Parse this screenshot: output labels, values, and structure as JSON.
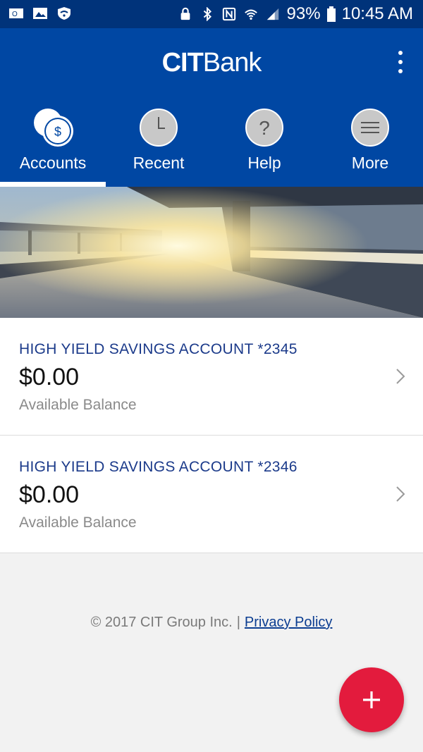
{
  "status_bar": {
    "left_icons": [
      "outlook-icon",
      "image-icon",
      "shield-wifi-icon"
    ],
    "right_icons": [
      "lock-icon",
      "bluetooth-icon",
      "nfc-icon",
      "wifi-icon",
      "signal-icon"
    ],
    "battery": "93%",
    "time": "10:45 AM"
  },
  "header": {
    "logo_cit": "CIT",
    "logo_bank": "Bank"
  },
  "tabs": [
    {
      "label": "Accounts",
      "icon": "accounts-icon",
      "active": true
    },
    {
      "label": "Recent",
      "icon": "clock-icon",
      "active": false
    },
    {
      "label": "Help",
      "icon": "help-icon",
      "active": false
    },
    {
      "label": "More",
      "icon": "menu-icon",
      "active": false
    }
  ],
  "accounts": [
    {
      "title": "HIGH YIELD SAVINGS ACCOUNT *2345",
      "balance": "$0.00",
      "caption": "Available Balance"
    },
    {
      "title": "HIGH YIELD SAVINGS ACCOUNT *2346",
      "balance": "$0.00",
      "caption": "Available Balance"
    }
  ],
  "footer": {
    "copyright": "© 2017 CIT Group Inc.",
    "separator": "|",
    "privacy_link": "Privacy Policy"
  },
  "colors": {
    "header_blue": "#0047a3",
    "status_blue": "#00337a",
    "account_title": "#1b3a8a",
    "fab_red": "#e31b3d"
  }
}
